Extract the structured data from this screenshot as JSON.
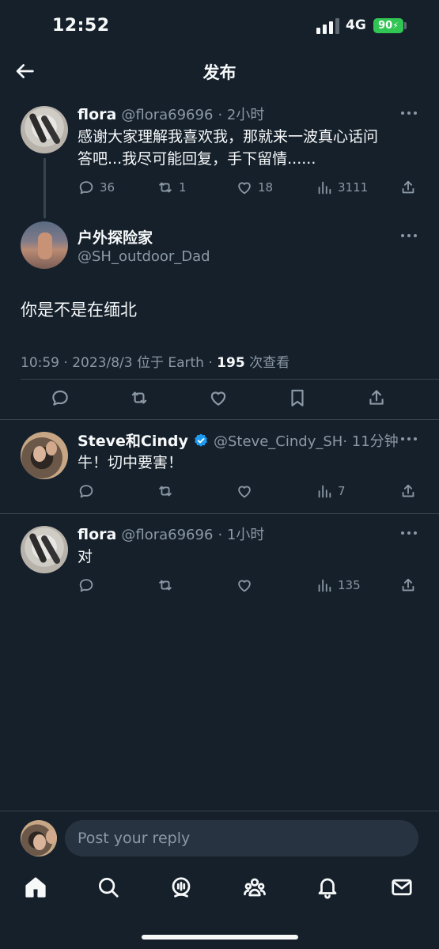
{
  "status_bar": {
    "time": "12:52",
    "network": "4G",
    "battery": "90"
  },
  "header": {
    "title": "发布"
  },
  "parent_tweet": {
    "name": "flora",
    "handle": "@flora69696",
    "time": "· 2小时",
    "text_line1": "感谢大家理解我喜欢我，那就来一波真心话问",
    "text_line2": "答吧...我尽可能回复，手下留情......",
    "replies": "36",
    "retweets": "1",
    "likes": "18",
    "views": "3111"
  },
  "main_tweet": {
    "name": "户外探险家",
    "handle": "@SH_outdoor_Dad",
    "text": "你是不是在缅北",
    "meta": "10:59 · 2023/8/3 位于 Earth · ",
    "views_count": "195",
    "views_label": " 次查看"
  },
  "replies": [
    {
      "name": "Steve和Cindy",
      "handle": "@Steve_Cindy_SH",
      "time": "· 11分钟",
      "text": "牛！切中要害！",
      "views": "7"
    },
    {
      "name": "flora",
      "handle": "@flora69696",
      "time": "· 1小时",
      "text": "对",
      "views": "135"
    }
  ],
  "reply_bar": {
    "placeholder": "Post your reply"
  },
  "icons": {
    "back": "arrow-left-icon",
    "reply": "speech-bubble-icon",
    "retweet": "retweet-icon",
    "like": "heart-icon",
    "views": "bar-chart-icon",
    "share": "share-icon",
    "bookmark": "bookmark-icon",
    "more": "more-dots-icon",
    "verified": "verified-badge-icon",
    "nav": [
      "home-icon",
      "search-icon",
      "spaces-icon",
      "communities-icon",
      "notifications-icon",
      "messages-icon"
    ]
  },
  "colors": {
    "background": "#15202b",
    "text": "#f7f9f9",
    "muted": "#8b98a5",
    "divider": "#38444d",
    "verified": "#1d9bf0",
    "battery": "#31c554"
  }
}
